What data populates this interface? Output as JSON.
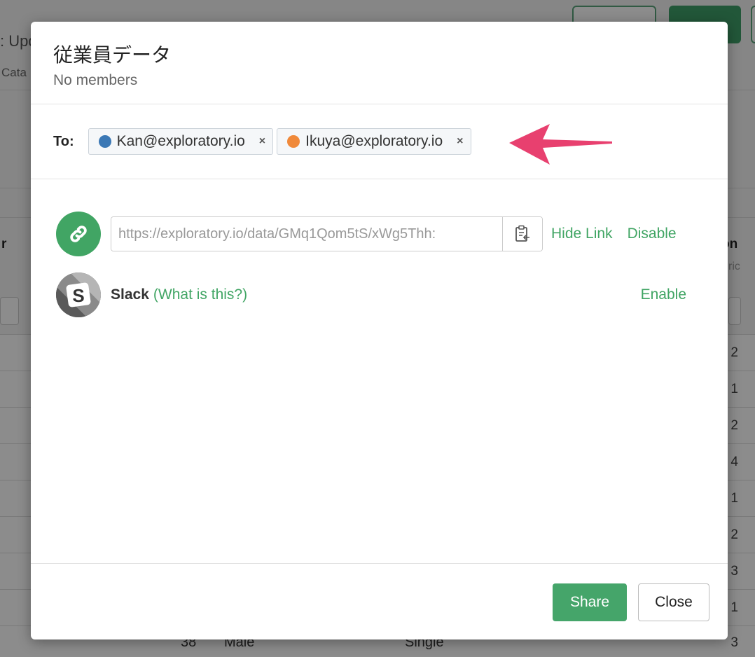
{
  "background": {
    "title_fragment": ": Upd",
    "subtitle_fragment": "Cata",
    "column_left_fragment": "r",
    "column_right_fragment": "on",
    "column_right_sub": "ric",
    "row_values": [
      "2",
      "1",
      "2",
      "4",
      "1",
      "2",
      "3",
      "1",
      "3"
    ],
    "last_row": {
      "age": "38",
      "gender": "Male",
      "status": "Single"
    }
  },
  "modal": {
    "title": "従業員データ",
    "subtitle": "No members",
    "to_label": "To:",
    "recipients": [
      {
        "email": "Kan@exploratory.io",
        "color": "#3b78b5",
        "remove": "×"
      },
      {
        "email": "Ikuya@exploratory.io",
        "color": "#f0893a",
        "remove": "×"
      }
    ],
    "link": {
      "url": "https://exploratory.io/data/GMq1Qom5tS/xWg5Thh:",
      "hide_label": "Hide Link",
      "disable_label": "Disable"
    },
    "slack": {
      "label": "Slack",
      "help": "(What is this?)",
      "enable_label": "Enable"
    },
    "footer": {
      "share_label": "Share",
      "close_label": "Close"
    }
  },
  "colors": {
    "accent": "#41a564",
    "arrow": "#e8406f"
  }
}
